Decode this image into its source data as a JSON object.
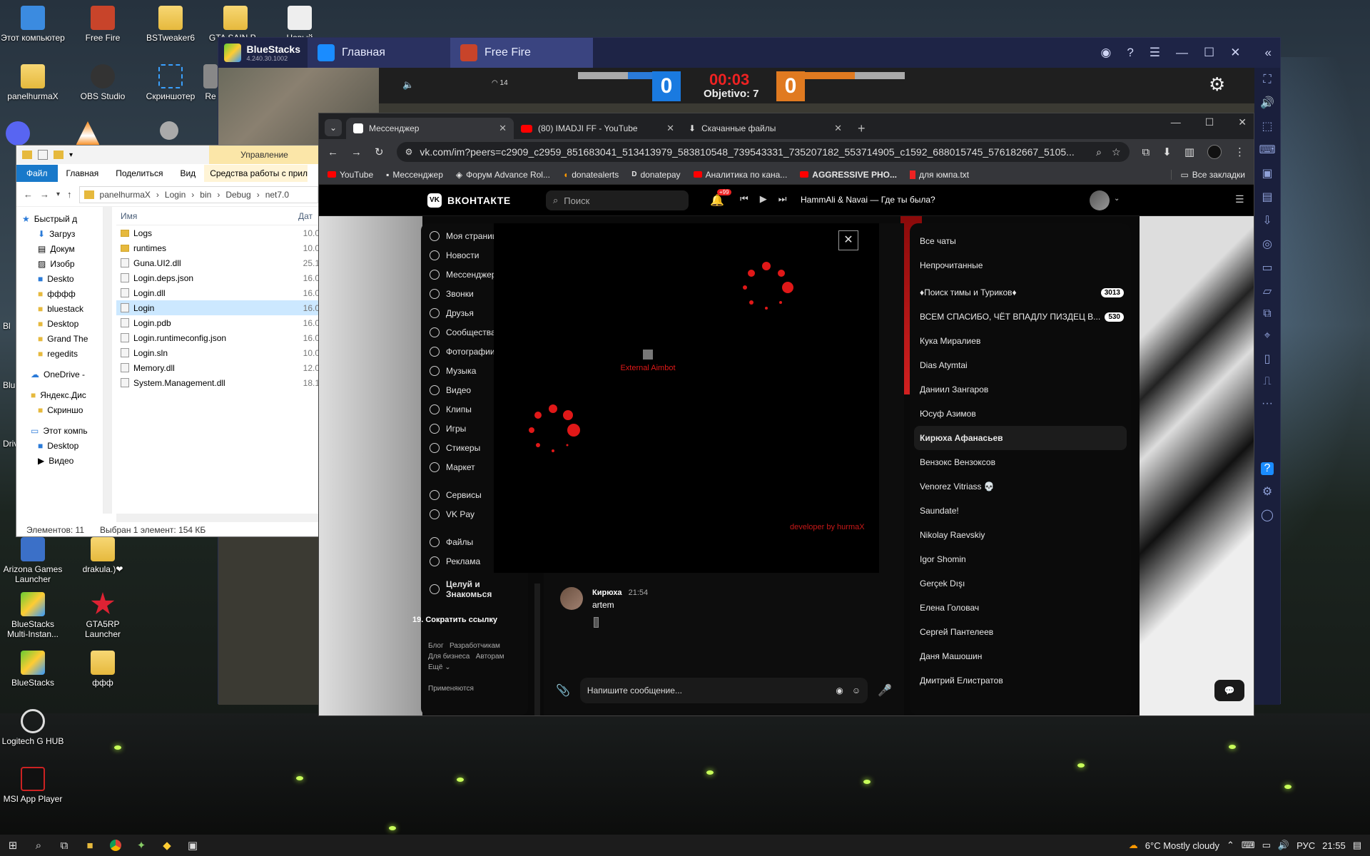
{
  "desktop": {
    "icons": [
      {
        "label": "Этот компьютер"
      },
      {
        "label": "Free Fire"
      },
      {
        "label": "BSTweaker6"
      },
      {
        "label": "GTA SAIN P..."
      },
      {
        "label": "Новый"
      },
      {
        "label": "panelhurmaX"
      },
      {
        "label": "OBS Studio"
      },
      {
        "label": "Скриншотер"
      },
      {
        "label": "Re"
      },
      {
        "label": "Arizona Games Launcher"
      },
      {
        "label": "drakula.)❤"
      },
      {
        "label": "BlueStacks Multi-Instan..."
      },
      {
        "label": "GTA5RP Launcher"
      },
      {
        "label": "BlueStacks"
      },
      {
        "label": "ффф"
      },
      {
        "label": "Logitech G HUB"
      },
      {
        "label": "MSI App Player"
      }
    ],
    "partial_labels": [
      "Bl",
      "Blu",
      "Driv"
    ]
  },
  "taskbar": {
    "weather": "6°C  Mostly cloudy",
    "lang": "РУС",
    "time": "21:55"
  },
  "bluestacks": {
    "brand": "BlueStacks",
    "version": "4.240.30.1002",
    "tabs": [
      {
        "label": "Главная"
      },
      {
        "label": "Free Fire"
      }
    ],
    "game": {
      "score_left": "0",
      "score_right": "0",
      "timer": "00:03",
      "objective": "Objetivo: 7",
      "wifi": "14"
    }
  },
  "explorer": {
    "ribbon_group": "Управление",
    "ribbon_tabs": [
      "Файл",
      "Главная",
      "Поделиться",
      "Вид",
      "Средства работы с прилож..."
    ],
    "path": [
      "panelhurmaX",
      "Login",
      "bin",
      "Debug",
      "net7.0"
    ],
    "col_name": "Имя",
    "col_date": "Дат",
    "sidebar": [
      "Быстрый д",
      "Загруз",
      "Докум",
      "Изобр",
      "Deskto",
      "фффф",
      "bluestack",
      "Desktop",
      "Grand The",
      "regedits",
      "OneDrive -",
      "Яндекс.Дис",
      "Скриншо",
      "Этот компь",
      "Desktop",
      "Видео"
    ],
    "files": [
      {
        "name": "Logs",
        "date": "10.0"
      },
      {
        "name": "runtimes",
        "date": "10.0"
      },
      {
        "name": "Guna.UI2.dll",
        "date": "25.1"
      },
      {
        "name": "Login.deps.json",
        "date": "16.0"
      },
      {
        "name": "Login.dll",
        "date": "16.0"
      },
      {
        "name": "Login",
        "date": "16.0"
      },
      {
        "name": "Login.pdb",
        "date": "16.0"
      },
      {
        "name": "Login.runtimeconfig.json",
        "date": "16.0"
      },
      {
        "name": "Login.sln",
        "date": "10.0"
      },
      {
        "name": "Memory.dll",
        "date": "12.0"
      },
      {
        "name": "System.Management.dll",
        "date": "18.1"
      }
    ],
    "status_count": "Элементов: 11",
    "status_sel": "Выбран 1 элемент: 154 КБ"
  },
  "chrome": {
    "tabs": [
      {
        "label": "Мессенджер"
      },
      {
        "label": "(80) IMADJI FF - YouTube"
      },
      {
        "label": "Скачанные файлы"
      }
    ],
    "url": "vk.com/im?peers=c2909_c2959_851683041_513413979_583810548_739543331_735207182_553714905_c1592_688015745_576182667_5105...",
    "bookmarks": [
      "YouTube",
      "Мессенджер",
      "Форум Advance Rol...",
      "donatealerts",
      "donatepay",
      "Аналитика по кана...",
      "AGGRESSIVE PHO...",
      "для юмпа.txt"
    ],
    "all_bookmarks": "Все закладки"
  },
  "vk": {
    "logo": "ВКОНТАКТЕ",
    "search": "Поиск",
    "notif_count": "+99",
    "track": "HammAli & Navai — Где ты была?",
    "nav": [
      "Моя страница",
      "Новости",
      "Мессенджер",
      "Звонки",
      "Друзья",
      "Сообщества",
      "Фотографии",
      "Музыка",
      "Видео",
      "Клипы",
      "Игры",
      "Стикеры",
      "Маркет",
      "Сервисы",
      "VK Pay",
      "Файлы",
      "Реклама",
      "Целуй и Знакомься"
    ],
    "short_link": "19. Сократить ссылку",
    "footer": [
      "Блог",
      "Разработчикам",
      "Для бизнеса",
      "Авторам",
      "Ещё"
    ],
    "footer_cut": "Применяются",
    "overlay": {
      "title": "External Aimbot",
      "credit": "developer by hurmaX"
    },
    "message": {
      "author": "Кирюха",
      "time": "21:54",
      "text": "artem"
    },
    "compose_placeholder": "Напишите сообщение...",
    "chat_filters": [
      "Все чаты",
      "Непрочитанные"
    ],
    "chats": [
      {
        "name": "♦Поиск тимы и Туриков♦",
        "badge": "3013"
      },
      {
        "name": "ВСЕМ СПАСИБО, ЧЁТ ВПАДЛУ ПИЗДЕЦ В...",
        "badge": "530"
      },
      {
        "name": "Кука Миралиев",
        "badge": ""
      },
      {
        "name": "Dias Atymtai",
        "badge": ""
      },
      {
        "name": "Даниил Зангаров",
        "badge": ""
      },
      {
        "name": "Юсуф Азимов",
        "badge": ""
      },
      {
        "name": "Кирюха Афанасьев",
        "badge": ""
      },
      {
        "name": "Вензокс Вензоксов",
        "badge": ""
      },
      {
        "name": "Venorez Vitriass 💀",
        "badge": ""
      },
      {
        "name": "Saundate!",
        "badge": ""
      },
      {
        "name": "Nikolay Raevskiy",
        "badge": ""
      },
      {
        "name": "Igor Shomin",
        "badge": ""
      },
      {
        "name": "Gerçek Dışı",
        "badge": ""
      },
      {
        "name": "Елена Головач",
        "badge": ""
      },
      {
        "name": "Сергей Пантелеев",
        "badge": ""
      },
      {
        "name": "Даня Машошин",
        "badge": ""
      },
      {
        "name": "Дмитрий Елистратов",
        "badge": ""
      }
    ]
  },
  "colors": {
    "accent_red": "#e01818",
    "bs_frame": "#1e2446",
    "vk_dark": "#0a0a0a"
  }
}
